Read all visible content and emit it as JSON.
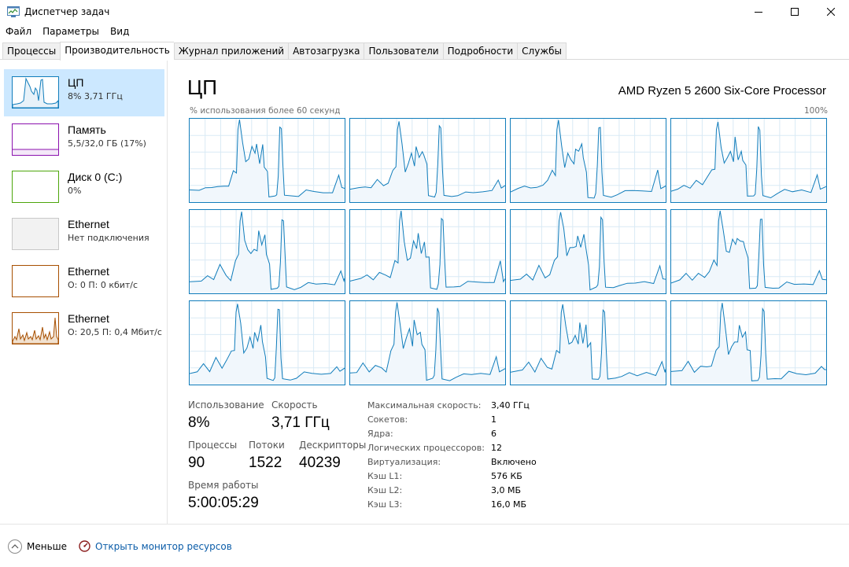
{
  "window": {
    "title": "Диспетчер задач"
  },
  "menu": [
    "Файл",
    "Параметры",
    "Вид"
  ],
  "tabs": [
    {
      "label": "Процессы"
    },
    {
      "label": "Производительность",
      "active": true
    },
    {
      "label": "Журнал приложений"
    },
    {
      "label": "Автозагрузка"
    },
    {
      "label": "Пользователи"
    },
    {
      "label": "Подробности"
    },
    {
      "label": "Службы"
    }
  ],
  "sidebar": {
    "items": [
      {
        "title": "ЦП",
        "subtitle": "8% 3,71 ГГц",
        "color": "#117dbb",
        "selected": true
      },
      {
        "title": "Память",
        "subtitle": "5,5/32,0 ГБ (17%)",
        "color": "#8b12ae"
      },
      {
        "title": "Диск 0 (C:)",
        "subtitle": "0%",
        "color": "#4da60c"
      },
      {
        "title": "Ethernet",
        "subtitle": "Нет подключения",
        "color": "#c8c8c8"
      },
      {
        "title": "Ethernet",
        "subtitle": "О: 0 П: 0 кбит/с",
        "color": "#a74f01"
      },
      {
        "title": "Ethernet",
        "subtitle": "О: 20,5 П: 0,4 Мбит/с",
        "color": "#a74f01"
      }
    ]
  },
  "main": {
    "title": "ЦП",
    "cpu_model": "AMD Ryzen 5 2600 Six-Core Processor",
    "axis_label": "% использования более 60 секунд",
    "axis_max": "100%",
    "graph_color": "#117dbb",
    "cores": 12
  },
  "stats": {
    "usage_label": "Использование",
    "usage_value": "8%",
    "speed_label": "Скорость",
    "speed_value": "3,71 ГГц",
    "processes_label": "Процессы",
    "processes_value": "90",
    "threads_label": "Потоки",
    "threads_value": "1522",
    "handles_label": "Дескрипторы",
    "handles_value": "40239",
    "uptime_label": "Время работы",
    "uptime_value": "5:00:05:29"
  },
  "info": [
    {
      "label": "Максимальная скорость:",
      "value": "3,40 ГГц"
    },
    {
      "label": "Сокетов:",
      "value": "1"
    },
    {
      "label": "Ядра:",
      "value": "6"
    },
    {
      "label": "Логических процессоров:",
      "value": "12"
    },
    {
      "label": "Виртуализация:",
      "value": "Включено"
    },
    {
      "label": "Кэш L1:",
      "value": "576 КБ"
    },
    {
      "label": "Кэш L2:",
      "value": "3,0 МБ"
    },
    {
      "label": "Кэш L3:",
      "value": "16,0 МБ"
    }
  ],
  "footer": {
    "fewer_label": "Меньше",
    "monitor_label": "Открыть монитор ресурсов"
  }
}
